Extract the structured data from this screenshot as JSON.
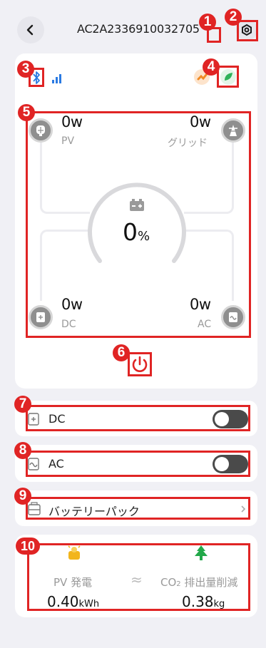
{
  "header": {
    "title": "AC2A2336910032705"
  },
  "main": {
    "pv": {
      "value": "0w",
      "label": "PV"
    },
    "grid": {
      "value": "0w",
      "label": "グリッド"
    },
    "dc": {
      "value": "0w",
      "label": "DC"
    },
    "ac": {
      "value": "0w",
      "label": "AC"
    },
    "battery": {
      "soc_value": "0",
      "soc_unit": "%"
    }
  },
  "outputs": {
    "dc_label": "DC",
    "dc_on": false,
    "ac_label": "AC",
    "ac_on": false,
    "battery_pack_label": "バッテリーパック"
  },
  "stats": {
    "pv_label": "PV 発電",
    "pv_value": "0.40",
    "pv_unit": "kWh",
    "approx": "≈",
    "co2_label_prefix": "CO",
    "co2_label_sub": "2",
    "co2_label_suffix": " 排出量削減",
    "co2_value": "0.38",
    "co2_unit": "kg"
  },
  "markers": [
    "1",
    "2",
    "3",
    "4",
    "5",
    "6",
    "7",
    "8",
    "9",
    "10"
  ],
  "colors": {
    "annotation": "#e02424",
    "bluetooth": "#2a7ae2",
    "eco_green": "#2fb25a",
    "power_red": "#e02424",
    "tree_green": "#22a84a",
    "sun_yellow": "#f2b51c"
  },
  "icons": {
    "back": "chevron-left-icon",
    "settings": "gear-icon",
    "bluetooth": "bluetooth-icon",
    "signal": "signal-bars-icon",
    "eco": "leaf-icon"
  }
}
